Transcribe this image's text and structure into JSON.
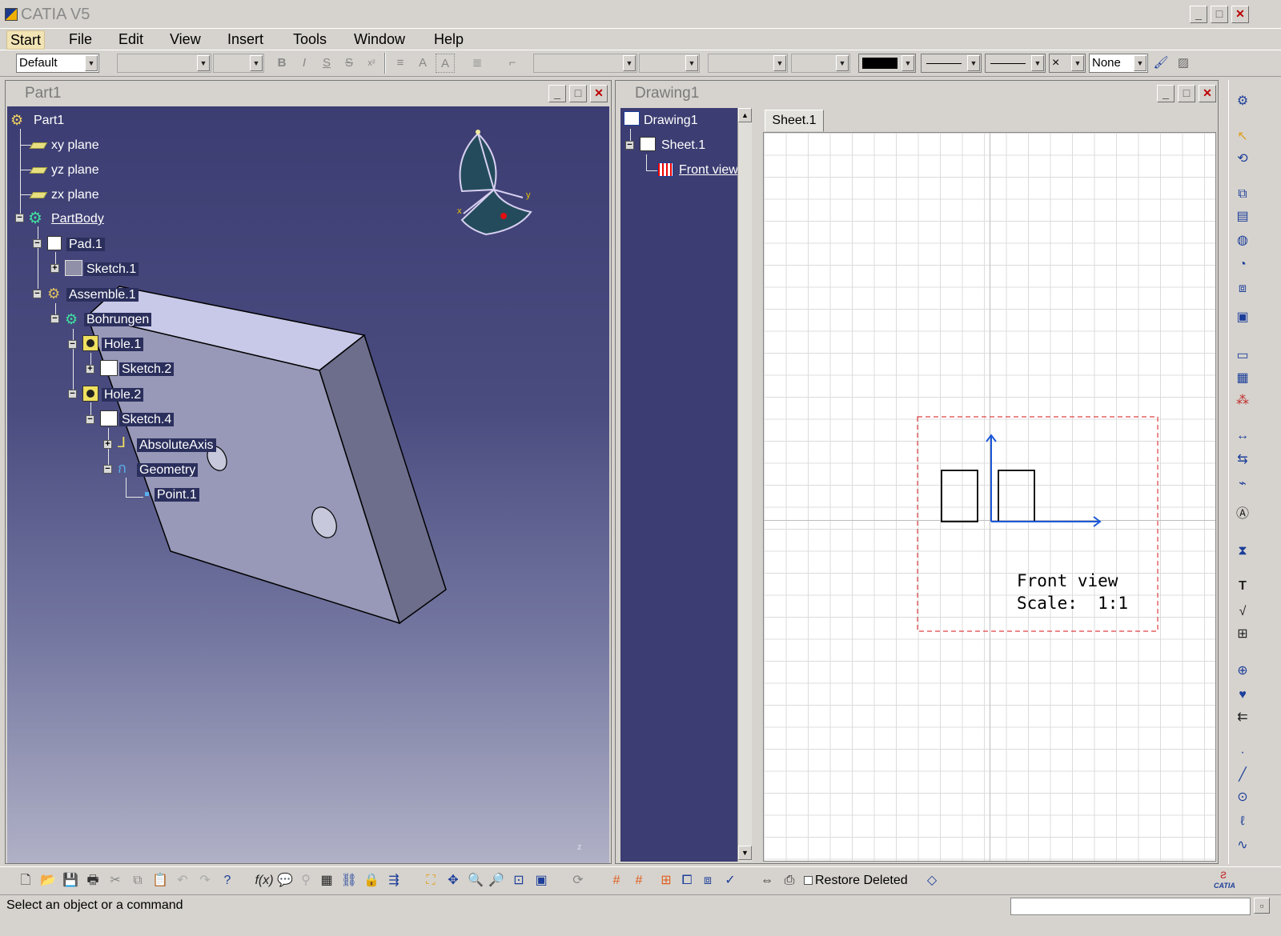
{
  "app": {
    "title": "CATIA V5"
  },
  "menu": [
    "Start",
    "File",
    "Edit",
    "View",
    "Insert",
    "Tools",
    "Window",
    "Help"
  ],
  "toolbar": {
    "style_combo": "Default",
    "line_color_combo": "",
    "fill_combo": "None"
  },
  "part_window": {
    "title": "Part1",
    "tree": [
      {
        "label": "Part1"
      },
      {
        "label": "xy plane"
      },
      {
        "label": "yz plane"
      },
      {
        "label": "zx plane"
      },
      {
        "label": "PartBody"
      },
      {
        "label": "Pad.1"
      },
      {
        "label": "Sketch.1"
      },
      {
        "label": "Assemble.1"
      },
      {
        "label": "Bohrungen"
      },
      {
        "label": "Hole.1"
      },
      {
        "label": "Sketch.2"
      },
      {
        "label": "Hole.2"
      },
      {
        "label": "Sketch.4"
      },
      {
        "label": "AbsoluteAxis"
      },
      {
        "label": "Geometry"
      },
      {
        "label": "Point.1"
      }
    ],
    "compass": {
      "x": "x",
      "y": "y",
      "z": "z"
    }
  },
  "drawing_window": {
    "title": "Drawing1",
    "tree": [
      {
        "label": "Drawing1"
      },
      {
        "label": "Sheet.1"
      },
      {
        "label": "Front view"
      }
    ],
    "sheet_tab": "Sheet.1",
    "view_label": "Front view",
    "view_scale": "Scale:  1:1"
  },
  "bottom_toolbar": {
    "restore_deleted": "Restore Deleted",
    "catia_logo": "CATIA"
  },
  "status": {
    "message": "Select an object or a command"
  }
}
